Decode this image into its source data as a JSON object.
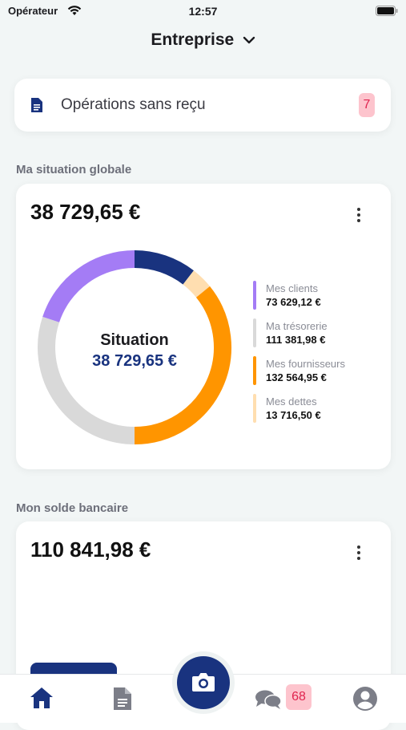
{
  "status_bar": {
    "carrier": "Opérateur",
    "time": "12:57"
  },
  "header": {
    "title": "Entreprise"
  },
  "operations": {
    "label": "Opérations sans reçu",
    "count": "7"
  },
  "situation": {
    "section_title": "Ma situation globale",
    "total": "38 729,65 €",
    "center_title": "Situation",
    "center_value": "38 729,65 €"
  },
  "chart_data": {
    "type": "pie",
    "title": "",
    "categories": [
      "Mes clients",
      "Ma trésorerie",
      "Mes fournisseurs",
      "Mes dettes"
    ],
    "values": [
      73629.12,
      111381.98,
      132564.95,
      13716.5
    ],
    "labels": [
      "73 629,12 €",
      "111 381,98 €",
      "132 564,95 €",
      "13 716,50 €"
    ],
    "colors": [
      "#a47cf5",
      "#d9d9d9",
      "#ff9500",
      "#ffdeb0"
    ],
    "extra_segment": {
      "value": 38729.65,
      "color": "#19337f"
    },
    "legend_position": "right"
  },
  "bank": {
    "section_title": "Mon solde bancaire",
    "total": "110 841,98 €"
  },
  "tabbar": {
    "chat_badge": "68"
  },
  "icons": {
    "home": "home-icon",
    "documents": "document-icon",
    "camera": "camera-icon",
    "chat": "chat-icon",
    "profile": "profile-icon"
  },
  "colors": {
    "brand": "#19337f",
    "badge_bg": "#fdc4cd",
    "badge_text": "#e0244f"
  }
}
